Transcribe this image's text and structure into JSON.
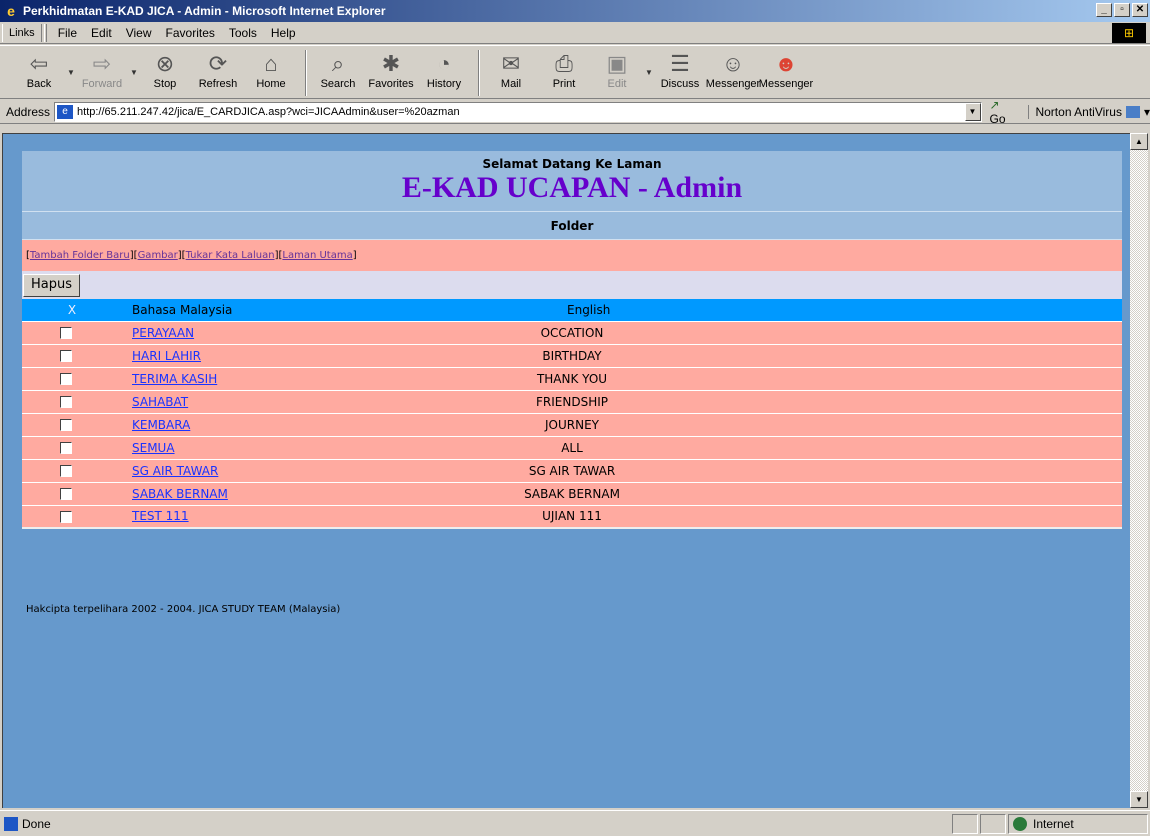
{
  "window": {
    "title": "Perkhidmatan E-KAD JICA - Admin - Microsoft Internet Explorer"
  },
  "menubar": {
    "links_label": "Links",
    "items": [
      "File",
      "Edit",
      "View",
      "Favorites",
      "Tools",
      "Help"
    ]
  },
  "toolbar": {
    "buttons": [
      {
        "label": "Back",
        "icon": "back-arrow-icon"
      },
      {
        "label": "Forward",
        "icon": "forward-arrow-icon"
      },
      {
        "label": "Stop",
        "icon": "stop-icon"
      },
      {
        "label": "Refresh",
        "icon": "refresh-icon"
      },
      {
        "label": "Home",
        "icon": "home-icon"
      },
      {
        "label": "Search",
        "icon": "search-icon"
      },
      {
        "label": "Favorites",
        "icon": "favorites-icon"
      },
      {
        "label": "History",
        "icon": "history-icon"
      },
      {
        "label": "Mail",
        "icon": "mail-icon"
      },
      {
        "label": "Print",
        "icon": "print-icon"
      },
      {
        "label": "Edit",
        "icon": "edit-icon"
      },
      {
        "label": "Discuss",
        "icon": "discuss-icon"
      },
      {
        "label": "Messenger",
        "icon": "messenger-icon"
      },
      {
        "label": "Messenger",
        "icon": "messenger-alt-icon"
      }
    ]
  },
  "address": {
    "label": "Address",
    "url": "http://65.211.247.42/jica/E_CARDJICA.asp?wci=JICAAdmin&user=%20azman",
    "go_label": "Go",
    "norton_label": "Norton AntiVirus"
  },
  "page": {
    "welcome": "Selamat Datang Ke Laman",
    "title": "E-KAD UCAPAN - Admin",
    "section": "Folder",
    "nav_links": [
      "Tambah Folder Baru",
      "Gambar",
      "Tukar Kata Laluan",
      "Laman Utama"
    ],
    "delete_button": "Hapus",
    "columns": {
      "select": "X",
      "malay": "Bahasa Malaysia",
      "english": "English"
    },
    "rows": [
      {
        "malay": "PERAYAAN",
        "english": "OCCATION"
      },
      {
        "malay": "HARI LAHIR",
        "english": "BIRTHDAY"
      },
      {
        "malay": "TERIMA KASIH",
        "english": "THANK YOU"
      },
      {
        "malay": "SAHABAT",
        "english": "FRIENDSHIP"
      },
      {
        "malay": "KEMBARA",
        "english": "JOURNEY"
      },
      {
        "malay": "SEMUA",
        "english": "ALL"
      },
      {
        "malay": "SG AIR TAWAR",
        "english": "SG AIR TAWAR"
      },
      {
        "malay": "SABAK BERNAM",
        "english": "SABAK BERNAM"
      },
      {
        "malay": "TEST 111",
        "english": "UJIAN 111"
      }
    ],
    "footer": "Hakcipta terpelihara 2002 - 2004. JICA STUDY TEAM (Malaysia)"
  },
  "status": {
    "text": "Done",
    "zone": "Internet"
  },
  "colors": {
    "page_bg": "#6699cc",
    "header_bg": "#99bbdd",
    "row_bg": "#ffaaa0",
    "column_header_bg": "#0099ff",
    "title_color": "#6600cc",
    "link_color": "#1a33ff"
  }
}
